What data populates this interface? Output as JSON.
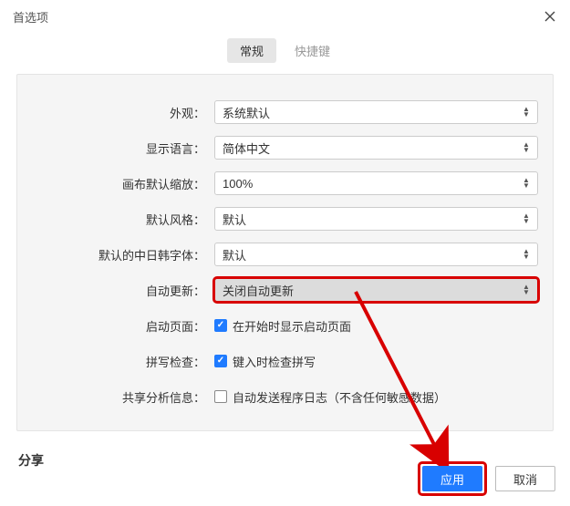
{
  "window": {
    "title": "首选项"
  },
  "tabs": {
    "general": "常规",
    "shortcuts": "快捷键"
  },
  "form": {
    "appearance": {
      "label": "外观：",
      "value": "系统默认"
    },
    "language": {
      "label": "显示语言：",
      "value": "简体中文"
    },
    "zoom": {
      "label": "画布默认缩放：",
      "value": "100%"
    },
    "style": {
      "label": "默认风格：",
      "value": "默认"
    },
    "cjkFont": {
      "label": "默认的中日韩字体：",
      "value": "默认"
    },
    "autoUpdate": {
      "label": "自动更新：",
      "value": "关闭自动更新"
    },
    "startPage": {
      "label": "启动页面：",
      "text": "在开始时显示启动页面",
      "checked": true
    },
    "spellCheck": {
      "label": "拼写检查：",
      "text": "键入时检查拼写",
      "checked": true
    },
    "analytics": {
      "label": "共享分析信息：",
      "text": "自动发送程序日志（不含任何敏感数据）",
      "checked": false
    }
  },
  "sections": {
    "share": "分享"
  },
  "buttons": {
    "apply": "应用",
    "cancel": "取消"
  }
}
